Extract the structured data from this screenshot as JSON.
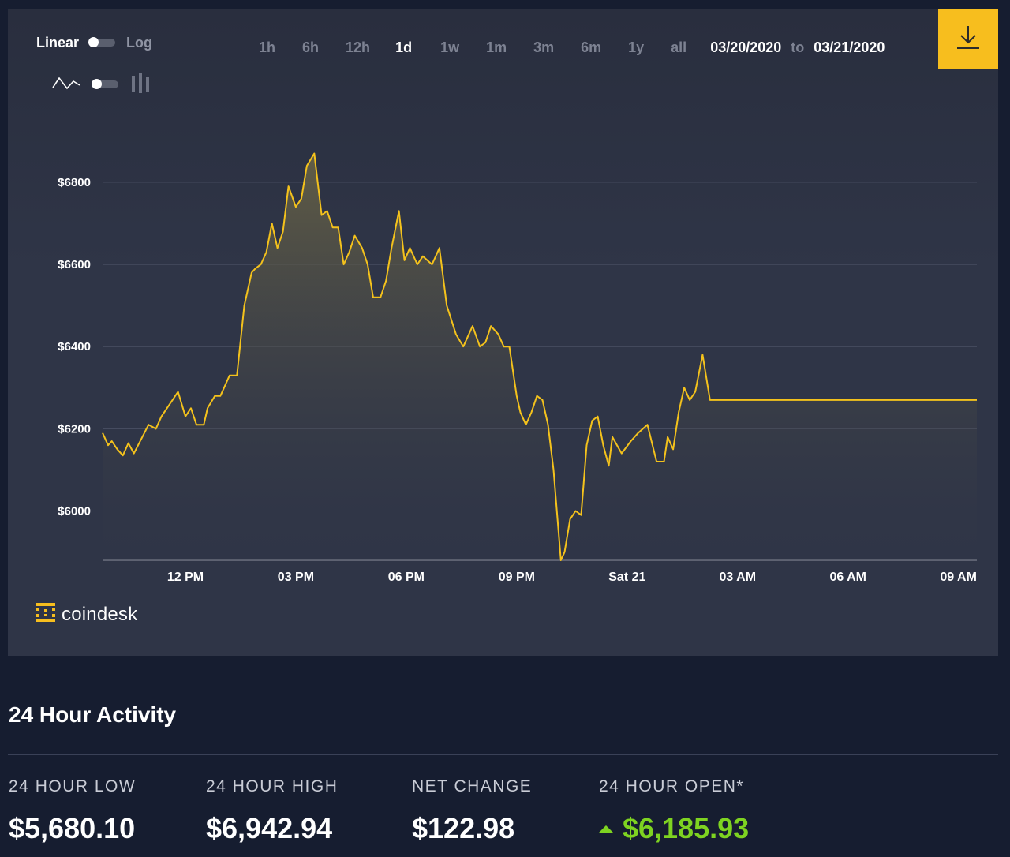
{
  "controls": {
    "scale_linear": "Linear",
    "scale_log": "Log",
    "ranges": [
      "1h",
      "6h",
      "12h",
      "1d",
      "1w",
      "1m",
      "3m",
      "6m",
      "1y",
      "all"
    ],
    "active_range": "1d",
    "date_from": "03/20/2020",
    "date_sep": "to",
    "date_to": "03/21/2020"
  },
  "logo": {
    "text": "coindesk"
  },
  "colors": {
    "accent": "#f7be1e",
    "line": "#f4c21c",
    "positive": "#7ed321",
    "panel": "#2f3547",
    "page": "#161d30"
  },
  "icons": {
    "download": "download-icon",
    "line_chart": "line-chart-icon",
    "candles": "candlestick-icon",
    "up": "arrow-up-icon"
  },
  "chart_data": {
    "type": "area",
    "xlabel": "",
    "ylabel": "",
    "ylim": [
      5880,
      6990
    ],
    "grid": true,
    "yticks": [
      6000,
      6200,
      6400,
      6600,
      6800
    ],
    "ytick_labels": [
      "$6000",
      "$6200",
      "$6400",
      "$6600",
      "$6800"
    ],
    "xticks": [
      {
        "label": "12 PM",
        "at": 1.5
      },
      {
        "label": "03 PM",
        "at": 4.5
      },
      {
        "label": "06 PM",
        "at": 7.5
      },
      {
        "label": "09 PM",
        "at": 10.5
      },
      {
        "label": "Sat 21",
        "at": 13.5
      },
      {
        "label": "03 AM",
        "at": 16.5
      },
      {
        "label": "06 AM",
        "at": 19.5
      },
      {
        "label": "09 AM",
        "at": 22.5
      }
    ],
    "xlim": [
      -0.75,
      23.0
    ],
    "series": [
      {
        "x": [
          -0.75,
          -0.6,
          -0.5,
          -0.35,
          -0.2,
          -0.05,
          0.1,
          0.3,
          0.5,
          0.7,
          0.85,
          1.0,
          1.15,
          1.3,
          1.5,
          1.65,
          1.8,
          2.0,
          2.1,
          2.3,
          2.45,
          2.55,
          2.7,
          2.9,
          3.1,
          3.3,
          3.4,
          3.55,
          3.7,
          3.85,
          4.0,
          4.15,
          4.3,
          4.5,
          4.65,
          4.8,
          5.0,
          5.2,
          5.35,
          5.5,
          5.65,
          5.8,
          5.95,
          6.1,
          6.3,
          6.45,
          6.6,
          6.8,
          6.95,
          7.1,
          7.3,
          7.45,
          7.6,
          7.8,
          7.95,
          8.2,
          8.4,
          8.6,
          8.85,
          9.05,
          9.3,
          9.5,
          9.65,
          9.8,
          10.0,
          10.15,
          10.3,
          10.5,
          10.6,
          10.75,
          10.9,
          11.05,
          11.2,
          11.35,
          11.5,
          11.7,
          11.8,
          11.95,
          12.1,
          12.25,
          12.4,
          12.55,
          12.7,
          12.85,
          13.0,
          13.1,
          13.35,
          13.6,
          13.8,
          14.05,
          14.3,
          14.5,
          14.6,
          14.75,
          14.9,
          15.05,
          15.2,
          15.35,
          15.55,
          15.75,
          15.95,
          16.1,
          16.3,
          16.5,
          16.65,
          16.8,
          16.95,
          17.15,
          17.3,
          17.45,
          17.7,
          17.85,
          18.05,
          18.25,
          18.45,
          18.65,
          18.9,
          19.1,
          19.3,
          19.45,
          19.6,
          19.8,
          20.0,
          20.2,
          20.45,
          20.65,
          20.85,
          21.05,
          21.2,
          21.4,
          21.6,
          21.8,
          21.95,
          22.15,
          22.3,
          22.5,
          22.65,
          22.85,
          23.0
        ],
        "y": [
          6190,
          6160,
          6170,
          6150,
          6135,
          6165,
          6140,
          6175,
          6210,
          6200,
          6230,
          6250,
          6270,
          6290,
          6230,
          6250,
          6210,
          6210,
          6250,
          6280,
          6280,
          6300,
          6330,
          6330,
          6500,
          6580,
          6590,
          6600,
          6630,
          6700,
          6640,
          6680,
          6790,
          6740,
          6760,
          6840,
          6870,
          6720,
          6730,
          6690,
          6690,
          6600,
          6630,
          6670,
          6640,
          6600,
          6520,
          6520,
          6560,
          6640,
          6730,
          6610,
          6640,
          6600,
          6620,
          6600,
          6640,
          6500,
          6430,
          6400,
          6450,
          6400,
          6410,
          6450,
          6430,
          6400,
          6400,
          6280,
          6240,
          6210,
          6240,
          6280,
          6270,
          6210,
          6100,
          5880,
          5900,
          5980,
          6000,
          5990,
          6160,
          6220,
          6230,
          6160,
          6110,
          6180,
          6140,
          6170,
          6190,
          6210,
          6120,
          6120,
          6180,
          6150,
          6240,
          6300,
          6270,
          6290,
          6380,
          6270,
          6270,
          6270,
          6270,
          6270,
          6270,
          6270,
          6270,
          6270,
          6270,
          6270,
          6270,
          6270,
          6270,
          6270,
          6270,
          6270,
          6270,
          6270,
          6270,
          6270,
          6270,
          6270,
          6270,
          6270,
          6270,
          6270,
          6270,
          6270,
          6270,
          6270,
          6270,
          6270,
          6270,
          6270,
          6270,
          6270,
          6270,
          6270,
          6270
        ]
      }
    ]
  },
  "activity": {
    "title": "24 Hour Activity",
    "stats": [
      {
        "label": "24 HOUR LOW",
        "value": "$5,680.10"
      },
      {
        "label": "24 HOUR HIGH",
        "value": "$6,942.94"
      },
      {
        "label": "NET CHANGE",
        "value": "$122.98"
      },
      {
        "label": "24 HOUR OPEN*",
        "value": "$6,185.93"
      }
    ]
  }
}
